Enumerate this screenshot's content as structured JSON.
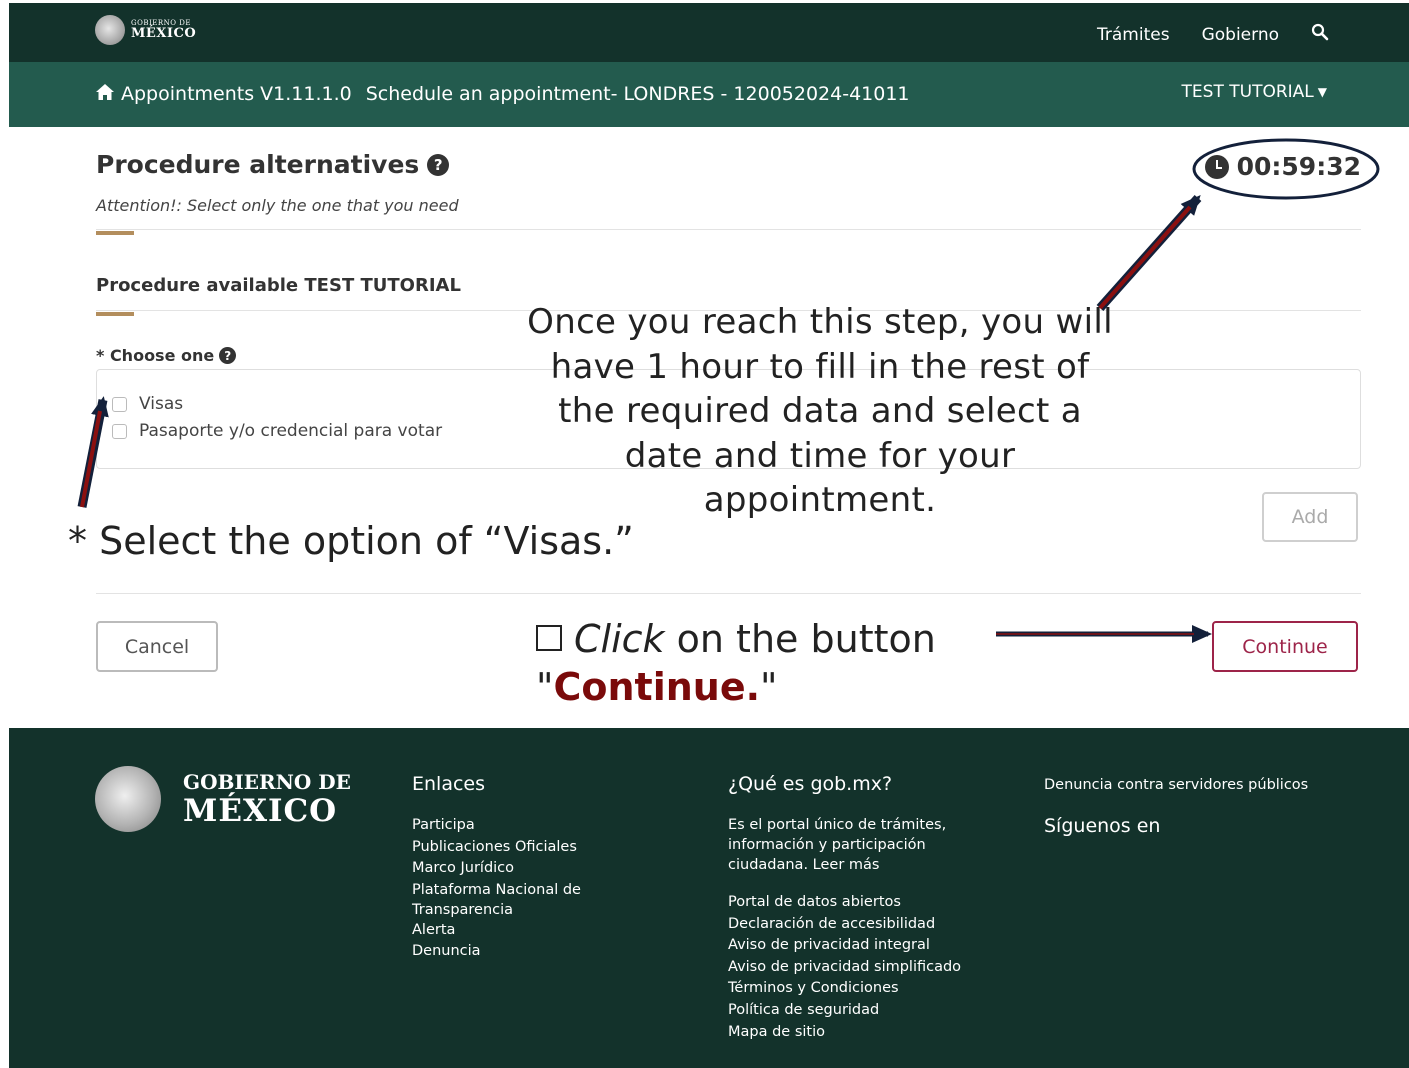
{
  "header": {
    "logo_line1": "GOBIERNO DE",
    "logo_line2": "MÉXICO",
    "nav": [
      "Trámites",
      "Gobierno"
    ],
    "search_icon": "search-icon"
  },
  "subheader": {
    "home_icon": "home-icon",
    "app": "Appointments V1.11.1.0",
    "page": "Schedule an appointment- LONDRES - 120052024-41011",
    "user": "TEST TUTORIAL"
  },
  "main": {
    "title": "Procedure alternatives",
    "timer": "00:59:32",
    "attention": "Attention!: Select only the one that you need",
    "procedure_heading": "Procedure available TEST TUTORIAL",
    "choose_label": "* Choose one",
    "options": [
      {
        "label": "Visas",
        "checked": false
      },
      {
        "label": "Pasaporte y/o credencial para votar",
        "checked": false
      }
    ],
    "add_label": "Add",
    "cancel_label": "Cancel",
    "continue_label": "Continue"
  },
  "annotations": {
    "timer_note": "Once you reach this step, you will have 1 hour to fill in the rest of the required data and select a date and time for your appointment.",
    "select_note_star": "*",
    "select_note": "Select the option of “Visas.”",
    "click_italic": "Click",
    "click_rest": "on the button",
    "click_open_quote": "\"",
    "click_continue": "Continue.",
    "click_close_quote": "\""
  },
  "footer": {
    "logo_line1": "GOBIERNO DE",
    "logo_line2": "MÉXICO",
    "enlaces_title": "Enlaces",
    "enlaces": [
      "Participa",
      "Publicaciones Oficiales",
      "Marco Jurídico",
      "Plataforma Nacional de Transparencia",
      "Alerta",
      "Denuncia"
    ],
    "que_title": "¿Qué es gob.mx?",
    "que_text": "Es el portal único de trámites, información y participación ciudadana. Leer más",
    "que_links": [
      "Portal de datos abiertos",
      "Declaración de accesibilidad",
      "Aviso de privacidad integral",
      "Aviso de privacidad simplificado",
      "Términos y Condiciones",
      "Política de seguridad",
      "Mapa de sitio"
    ],
    "denuncia": "Denuncia contra servidores públicos",
    "siguenos": "Síguenos en"
  },
  "colors": {
    "header_dark": "#13322b",
    "header_green": "#235b4e",
    "accent_gold": "#b38e5d",
    "continue_red": "#9d2449",
    "arrow_red": "#8b1010"
  }
}
